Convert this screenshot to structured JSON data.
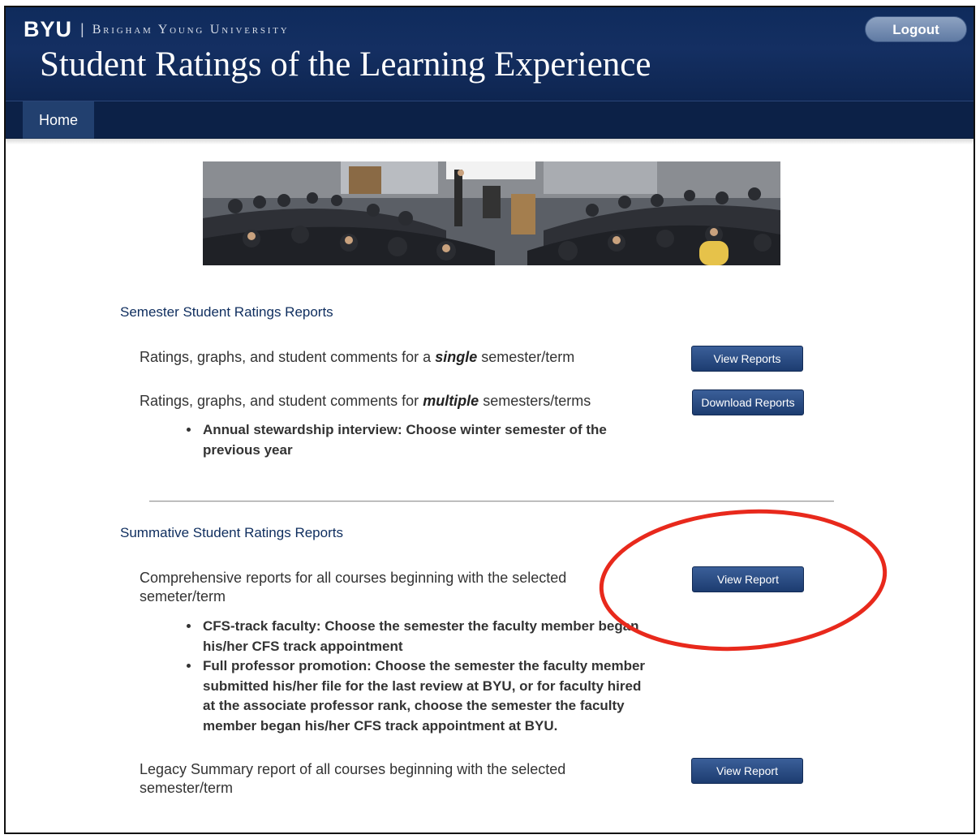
{
  "header": {
    "brand_logo": "BYU",
    "brand_separator": "|",
    "brand_name": "Brigham Young University",
    "title": "Student Ratings of the Learning Experience",
    "logout_label": "Logout",
    "background_color": "#142f62"
  },
  "nav": {
    "items": [
      {
        "label": "Home",
        "active": true
      }
    ]
  },
  "banner": {
    "image": "classroom-lecture-photo"
  },
  "semester_section": {
    "title": "Semester Student Ratings Reports",
    "rows": [
      {
        "text_before": "Ratings, graphs, and student comments for a ",
        "text_emphasis": "single",
        "text_after": " semester/term",
        "button_label": "View Reports"
      },
      {
        "text_before": "Ratings, graphs, and student comments for ",
        "text_emphasis": "multiple",
        "text_after": " semesters/terms",
        "button_label": "Download Reports",
        "bullets": [
          "Annual stewardship interview: Choose winter semester of the previous year"
        ]
      }
    ]
  },
  "summative_section": {
    "title": "Summative Student Ratings Reports",
    "rows": [
      {
        "text": "Comprehensive reports for all courses beginning with the selected semeter/term",
        "button_label": "View Report",
        "bullets": [
          "CFS-track faculty: Choose the semester the faculty member began his/her CFS track appointment",
          "Full professor promotion: Choose the semester the faculty member submitted his/her file for the last review at BYU, or for faculty hired at the associate professor rank, choose the semester the faculty member began his/her CFS track appointment at BYU."
        ]
      },
      {
        "text": "Legacy Summary report of all courses beginning with the selected semester/term",
        "button_label": "View Report"
      }
    ]
  },
  "annotation": {
    "shape": "ellipse",
    "color": "#e8291c"
  },
  "colors": {
    "accent": "#0e2d5e",
    "button": "#2b4b82"
  }
}
